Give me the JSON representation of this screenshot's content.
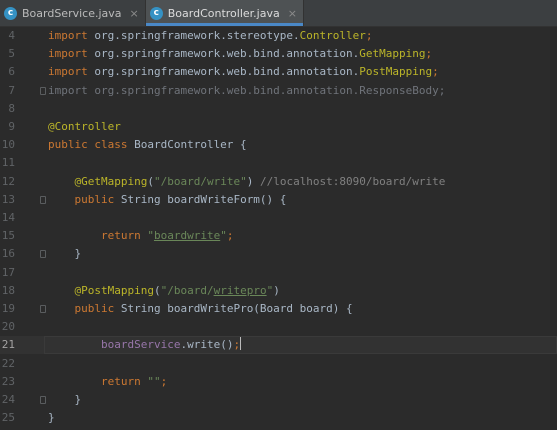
{
  "tabs": [
    {
      "label": "BoardService.java",
      "active": false
    },
    {
      "label": "BoardController.java",
      "active": true
    }
  ],
  "tab_icon_letter": "c",
  "tab_close_glyph": "×",
  "lines": [
    {
      "num": "4",
      "tokens": [
        {
          "t": "import ",
          "c": "kw"
        },
        {
          "t": "org.springframework.stereotype.",
          "c": "plain"
        },
        {
          "t": "Controller",
          "c": "ann"
        },
        {
          "t": ";",
          "c": "kw"
        }
      ]
    },
    {
      "num": "5",
      "tokens": [
        {
          "t": "import ",
          "c": "kw"
        },
        {
          "t": "org.springframework.web.bind.annotation.",
          "c": "plain"
        },
        {
          "t": "GetMapping",
          "c": "ann"
        },
        {
          "t": ";",
          "c": "kw"
        }
      ]
    },
    {
      "num": "6",
      "tokens": [
        {
          "t": "import ",
          "c": "kw"
        },
        {
          "t": "org.springframework.web.bind.annotation.",
          "c": "plain"
        },
        {
          "t": "PostMapping",
          "c": "ann"
        },
        {
          "t": ";",
          "c": "kw"
        }
      ]
    },
    {
      "num": "7",
      "fold": true,
      "tokens": [
        {
          "t": "import org.springframework.web.bind.annotation.ResponseBody;",
          "c": "dim"
        }
      ]
    },
    {
      "num": "8",
      "tokens": []
    },
    {
      "num": "9",
      "tokens": [
        {
          "t": "@Controller",
          "c": "ann"
        }
      ]
    },
    {
      "num": "10",
      "tokens": [
        {
          "t": "public class ",
          "c": "kw"
        },
        {
          "t": "BoardController {",
          "c": "plain"
        }
      ]
    },
    {
      "num": "11",
      "tokens": []
    },
    {
      "num": "12",
      "tokens": [
        {
          "t": "    ",
          "c": "plain"
        },
        {
          "t": "@GetMapping",
          "c": "ann"
        },
        {
          "t": "(",
          "c": "plain"
        },
        {
          "t": "\"/board/write\"",
          "c": "str"
        },
        {
          "t": ") ",
          "c": "plain"
        },
        {
          "t": "//localhost:8090/board/write",
          "c": "cmt"
        }
      ]
    },
    {
      "num": "13",
      "fold": true,
      "tokens": [
        {
          "t": "    ",
          "c": "plain"
        },
        {
          "t": "public ",
          "c": "kw"
        },
        {
          "t": "String boardWriteForm() {",
          "c": "plain"
        }
      ]
    },
    {
      "num": "14",
      "tokens": []
    },
    {
      "num": "15",
      "tokens": [
        {
          "t": "        ",
          "c": "plain"
        },
        {
          "t": "return ",
          "c": "kw"
        },
        {
          "t": "\"",
          "c": "str"
        },
        {
          "t": "boardwrite",
          "c": "str ul"
        },
        {
          "t": "\"",
          "c": "str"
        },
        {
          "t": ";",
          "c": "kw"
        }
      ]
    },
    {
      "num": "16",
      "fold": true,
      "tokens": [
        {
          "t": "    }",
          "c": "plain"
        }
      ]
    },
    {
      "num": "17",
      "tokens": []
    },
    {
      "num": "18",
      "tokens": [
        {
          "t": "    ",
          "c": "plain"
        },
        {
          "t": "@PostMapping",
          "c": "ann"
        },
        {
          "t": "(",
          "c": "plain"
        },
        {
          "t": "\"/board/",
          "c": "str"
        },
        {
          "t": "writepro",
          "c": "str ul"
        },
        {
          "t": "\"",
          "c": "str"
        },
        {
          "t": ")",
          "c": "plain"
        }
      ]
    },
    {
      "num": "19",
      "fold": true,
      "tokens": [
        {
          "t": "    ",
          "c": "plain"
        },
        {
          "t": "public ",
          "c": "kw"
        },
        {
          "t": "String boardWritePro(Board board) {",
          "c": "plain"
        }
      ]
    },
    {
      "num": "20",
      "tokens": []
    },
    {
      "num": "21",
      "current": true,
      "tokens": [
        {
          "t": "        ",
          "c": "plain"
        },
        {
          "t": "boardService",
          "c": "field"
        },
        {
          "t": ".write()",
          "c": "plain"
        },
        {
          "t": ";",
          "c": "kw"
        }
      ]
    },
    {
      "num": "22",
      "tokens": []
    },
    {
      "num": "23",
      "tokens": [
        {
          "t": "        ",
          "c": "plain"
        },
        {
          "t": "return ",
          "c": "kw"
        },
        {
          "t": "\"\"",
          "c": "str"
        },
        {
          "t": ";",
          "c": "kw"
        }
      ]
    },
    {
      "num": "24",
      "fold": true,
      "tokens": [
        {
          "t": "    }",
          "c": "plain"
        }
      ]
    },
    {
      "num": "25",
      "tokens": [
        {
          "t": "}",
          "c": "plain"
        }
      ]
    }
  ],
  "colors": {
    "background": "#2b2b2b",
    "keyword": "#cc7832",
    "string": "#6a8759",
    "annotation": "#bbb529",
    "comment": "#808080",
    "field": "#9876aa",
    "text": "#a9b7c6",
    "tab_accent": "#4a88c7"
  }
}
